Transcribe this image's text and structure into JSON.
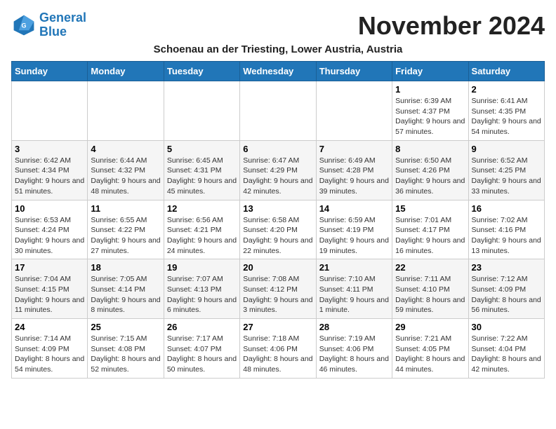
{
  "header": {
    "logo_line1": "General",
    "logo_line2": "Blue",
    "month_title": "November 2024",
    "subtitle": "Schoenau an der Triesting, Lower Austria, Austria"
  },
  "weekdays": [
    "Sunday",
    "Monday",
    "Tuesday",
    "Wednesday",
    "Thursday",
    "Friday",
    "Saturday"
  ],
  "weeks": [
    [
      {
        "day": "",
        "info": ""
      },
      {
        "day": "",
        "info": ""
      },
      {
        "day": "",
        "info": ""
      },
      {
        "day": "",
        "info": ""
      },
      {
        "day": "",
        "info": ""
      },
      {
        "day": "1",
        "info": "Sunrise: 6:39 AM\nSunset: 4:37 PM\nDaylight: 9 hours and 57 minutes."
      },
      {
        "day": "2",
        "info": "Sunrise: 6:41 AM\nSunset: 4:35 PM\nDaylight: 9 hours and 54 minutes."
      }
    ],
    [
      {
        "day": "3",
        "info": "Sunrise: 6:42 AM\nSunset: 4:34 PM\nDaylight: 9 hours and 51 minutes."
      },
      {
        "day": "4",
        "info": "Sunrise: 6:44 AM\nSunset: 4:32 PM\nDaylight: 9 hours and 48 minutes."
      },
      {
        "day": "5",
        "info": "Sunrise: 6:45 AM\nSunset: 4:31 PM\nDaylight: 9 hours and 45 minutes."
      },
      {
        "day": "6",
        "info": "Sunrise: 6:47 AM\nSunset: 4:29 PM\nDaylight: 9 hours and 42 minutes."
      },
      {
        "day": "7",
        "info": "Sunrise: 6:49 AM\nSunset: 4:28 PM\nDaylight: 9 hours and 39 minutes."
      },
      {
        "day": "8",
        "info": "Sunrise: 6:50 AM\nSunset: 4:26 PM\nDaylight: 9 hours and 36 minutes."
      },
      {
        "day": "9",
        "info": "Sunrise: 6:52 AM\nSunset: 4:25 PM\nDaylight: 9 hours and 33 minutes."
      }
    ],
    [
      {
        "day": "10",
        "info": "Sunrise: 6:53 AM\nSunset: 4:24 PM\nDaylight: 9 hours and 30 minutes."
      },
      {
        "day": "11",
        "info": "Sunrise: 6:55 AM\nSunset: 4:22 PM\nDaylight: 9 hours and 27 minutes."
      },
      {
        "day": "12",
        "info": "Sunrise: 6:56 AM\nSunset: 4:21 PM\nDaylight: 9 hours and 24 minutes."
      },
      {
        "day": "13",
        "info": "Sunrise: 6:58 AM\nSunset: 4:20 PM\nDaylight: 9 hours and 22 minutes."
      },
      {
        "day": "14",
        "info": "Sunrise: 6:59 AM\nSunset: 4:19 PM\nDaylight: 9 hours and 19 minutes."
      },
      {
        "day": "15",
        "info": "Sunrise: 7:01 AM\nSunset: 4:17 PM\nDaylight: 9 hours and 16 minutes."
      },
      {
        "day": "16",
        "info": "Sunrise: 7:02 AM\nSunset: 4:16 PM\nDaylight: 9 hours and 13 minutes."
      }
    ],
    [
      {
        "day": "17",
        "info": "Sunrise: 7:04 AM\nSunset: 4:15 PM\nDaylight: 9 hours and 11 minutes."
      },
      {
        "day": "18",
        "info": "Sunrise: 7:05 AM\nSunset: 4:14 PM\nDaylight: 9 hours and 8 minutes."
      },
      {
        "day": "19",
        "info": "Sunrise: 7:07 AM\nSunset: 4:13 PM\nDaylight: 9 hours and 6 minutes."
      },
      {
        "day": "20",
        "info": "Sunrise: 7:08 AM\nSunset: 4:12 PM\nDaylight: 9 hours and 3 minutes."
      },
      {
        "day": "21",
        "info": "Sunrise: 7:10 AM\nSunset: 4:11 PM\nDaylight: 9 hours and 1 minute."
      },
      {
        "day": "22",
        "info": "Sunrise: 7:11 AM\nSunset: 4:10 PM\nDaylight: 8 hours and 59 minutes."
      },
      {
        "day": "23",
        "info": "Sunrise: 7:12 AM\nSunset: 4:09 PM\nDaylight: 8 hours and 56 minutes."
      }
    ],
    [
      {
        "day": "24",
        "info": "Sunrise: 7:14 AM\nSunset: 4:09 PM\nDaylight: 8 hours and 54 minutes."
      },
      {
        "day": "25",
        "info": "Sunrise: 7:15 AM\nSunset: 4:08 PM\nDaylight: 8 hours and 52 minutes."
      },
      {
        "day": "26",
        "info": "Sunrise: 7:17 AM\nSunset: 4:07 PM\nDaylight: 8 hours and 50 minutes."
      },
      {
        "day": "27",
        "info": "Sunrise: 7:18 AM\nSunset: 4:06 PM\nDaylight: 8 hours and 48 minutes."
      },
      {
        "day": "28",
        "info": "Sunrise: 7:19 AM\nSunset: 4:06 PM\nDaylight: 8 hours and 46 minutes."
      },
      {
        "day": "29",
        "info": "Sunrise: 7:21 AM\nSunset: 4:05 PM\nDaylight: 8 hours and 44 minutes."
      },
      {
        "day": "30",
        "info": "Sunrise: 7:22 AM\nSunset: 4:04 PM\nDaylight: 8 hours and 42 minutes."
      }
    ]
  ]
}
